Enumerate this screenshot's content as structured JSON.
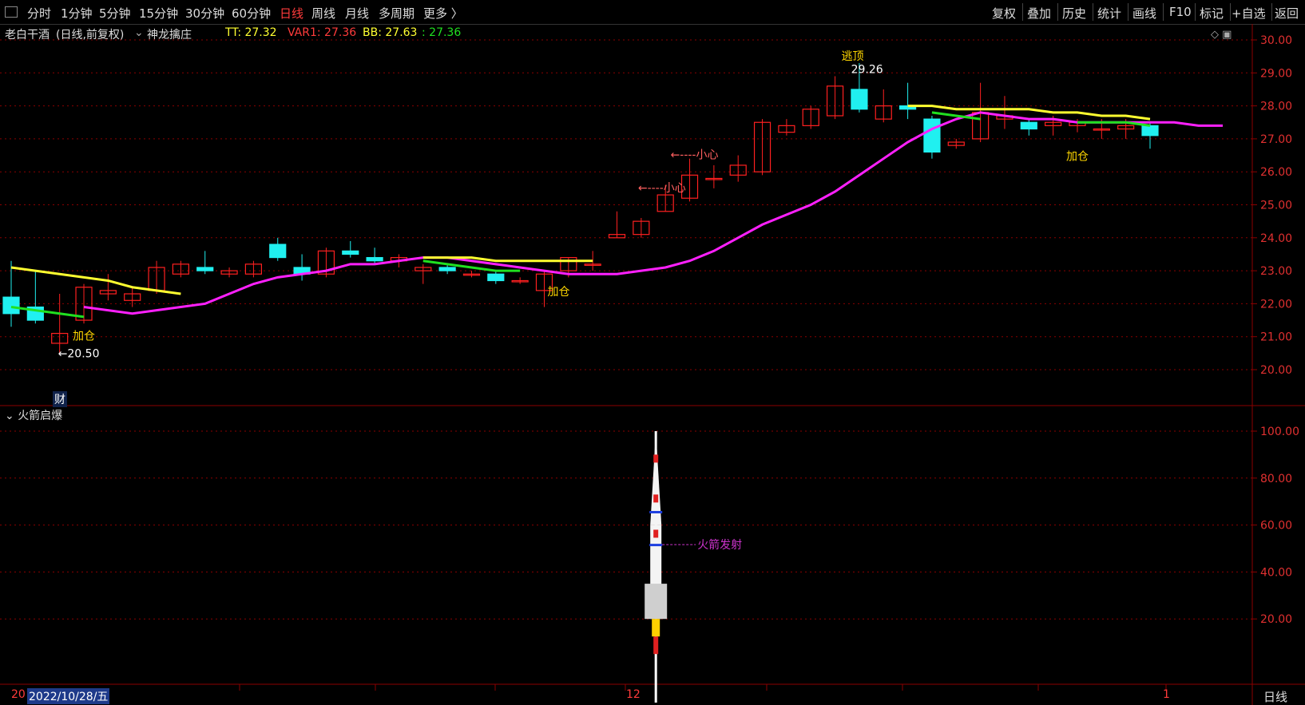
{
  "menu": {
    "left": [
      "分时",
      "1分钟",
      "5分钟",
      "15分钟",
      "30分钟",
      "60分钟",
      "日线",
      "周线",
      "月线",
      "多周期",
      "更多 〉"
    ],
    "active": "日线",
    "right": [
      "复权",
      "叠加",
      "历史",
      "统计",
      "画线",
      "F10",
      "标记",
      "+自选",
      "返回"
    ]
  },
  "stock": {
    "name": "老白干酒",
    "mode": "(日线,前复权)",
    "indicator": "神龙擒庄",
    "tt": "TT: 27.32",
    "var1": "VAR1: 27.36",
    "bb": "BB: 27.63",
    "bb2": ": 27.36"
  },
  "sub_panel": {
    "title": "火箭启爆",
    "label": "火箭发射"
  },
  "annotations": {
    "add1": "加仓",
    "add2": "加仓",
    "add3": "加仓",
    "low": "←20.50",
    "high": "29.26",
    "top": "逃顶",
    "careful1": "←----小心",
    "careful2": "←----小心",
    "finance": "财"
  },
  "bottom": {
    "start": "20",
    "date": "2022/10/28/五",
    "month12": "12",
    "month1": "1",
    "period": "日线"
  },
  "colors": {
    "up": "#ff2020",
    "down": "#20f0f0",
    "ma": "#ff20ff",
    "yellow": "#ffff30",
    "green": "#20e020",
    "grid": "#8b0000"
  },
  "chart_data": {
    "type": "candlestick",
    "main_axis": [
      "30.00",
      "29.00",
      "28.00",
      "27.00",
      "26.00",
      "25.00",
      "24.00",
      "23.00",
      "22.00",
      "21.00",
      "20.00"
    ],
    "sub_axis": [
      "100.00",
      "80.00",
      "60.00",
      "40.00",
      "20.00"
    ],
    "candles": [
      {
        "o": 22.2,
        "c": 21.7,
        "h": 23.3,
        "l": 21.3
      },
      {
        "o": 21.9,
        "c": 21.5,
        "h": 23.0,
        "l": 21.4
      },
      {
        "o": 20.8,
        "c": 21.1,
        "h": 22.3,
        "l": 20.5
      },
      {
        "o": 21.5,
        "c": 22.5,
        "h": 22.6,
        "l": 21.4
      },
      {
        "o": 22.3,
        "c": 22.4,
        "h": 22.9,
        "l": 22.1
      },
      {
        "o": 22.1,
        "c": 22.3,
        "h": 22.5,
        "l": 21.9
      },
      {
        "o": 22.4,
        "c": 23.1,
        "h": 23.3,
        "l": 22.3
      },
      {
        "o": 22.9,
        "c": 23.2,
        "h": 23.3,
        "l": 22.8
      },
      {
        "o": 23.1,
        "c": 23.0,
        "h": 23.6,
        "l": 22.9
      },
      {
        "o": 22.9,
        "c": 23.0,
        "h": 23.1,
        "l": 22.8
      },
      {
        "o": 22.9,
        "c": 23.2,
        "h": 23.3,
        "l": 22.8
      },
      {
        "o": 23.8,
        "c": 23.4,
        "h": 24.0,
        "l": 23.3
      },
      {
        "o": 23.1,
        "c": 22.9,
        "h": 23.5,
        "l": 22.7
      },
      {
        "o": 22.9,
        "c": 23.6,
        "h": 23.7,
        "l": 22.8
      },
      {
        "o": 23.6,
        "c": 23.5,
        "h": 23.9,
        "l": 23.4
      },
      {
        "o": 23.4,
        "c": 23.3,
        "h": 23.7,
        "l": 23.2
      },
      {
        "o": 23.3,
        "c": 23.4,
        "h": 23.5,
        "l": 23.1
      },
      {
        "o": 23.0,
        "c": 23.1,
        "h": 23.2,
        "l": 22.6
      },
      {
        "o": 23.1,
        "c": 23.0,
        "h": 23.2,
        "l": 22.9
      },
      {
        "o": 22.9,
        "c": 22.9,
        "h": 23.0,
        "l": 22.8
      },
      {
        "o": 22.9,
        "c": 22.7,
        "h": 23.0,
        "l": 22.6
      },
      {
        "o": 22.7,
        "c": 22.7,
        "h": 22.8,
        "l": 22.6
      },
      {
        "o": 22.4,
        "c": 22.9,
        "h": 23.0,
        "l": 21.9
      },
      {
        "o": 23.0,
        "c": 23.4,
        "h": 23.4,
        "l": 22.8
      },
      {
        "o": 23.2,
        "c": 23.2,
        "h": 23.6,
        "l": 23.0
      },
      {
        "o": 24.0,
        "c": 24.1,
        "h": 24.8,
        "l": 24.0
      },
      {
        "o": 24.1,
        "c": 24.5,
        "h": 24.6,
        "l": 24.0
      },
      {
        "o": 24.8,
        "c": 25.3,
        "h": 25.6,
        "l": 24.8
      },
      {
        "o": 25.2,
        "c": 25.9,
        "h": 26.4,
        "l": 25.1
      },
      {
        "o": 25.8,
        "c": 25.8,
        "h": 26.2,
        "l": 25.5
      },
      {
        "o": 25.9,
        "c": 26.2,
        "h": 26.5,
        "l": 25.7
      },
      {
        "o": 26.0,
        "c": 27.5,
        "h": 27.6,
        "l": 25.9
      },
      {
        "o": 27.2,
        "c": 27.4,
        "h": 27.6,
        "l": 27.1
      },
      {
        "o": 27.4,
        "c": 27.9,
        "h": 28.0,
        "l": 27.3
      },
      {
        "o": 27.7,
        "c": 28.6,
        "h": 28.9,
        "l": 27.6
      },
      {
        "o": 28.5,
        "c": 27.9,
        "h": 29.3,
        "l": 27.8
      },
      {
        "o": 27.6,
        "c": 28.0,
        "h": 28.5,
        "l": 27.5
      },
      {
        "o": 28.0,
        "c": 27.9,
        "h": 28.7,
        "l": 27.6
      },
      {
        "o": 27.6,
        "c": 26.6,
        "h": 27.7,
        "l": 26.4
      },
      {
        "o": 26.8,
        "c": 26.9,
        "h": 27.0,
        "l": 26.7
      },
      {
        "o": 27.0,
        "c": 27.8,
        "h": 28.7,
        "l": 26.9
      },
      {
        "o": 27.6,
        "c": 27.7,
        "h": 28.3,
        "l": 27.3
      },
      {
        "o": 27.5,
        "c": 27.3,
        "h": 27.6,
        "l": 27.1
      },
      {
        "o": 27.4,
        "c": 27.5,
        "h": 27.7,
        "l": 27.1
      },
      {
        "o": 27.4,
        "c": 27.5,
        "h": 27.6,
        "l": 27.2
      },
      {
        "o": 27.3,
        "c": 27.3,
        "h": 27.6,
        "l": 27.0
      },
      {
        "o": 27.3,
        "c": 27.4,
        "h": 27.6,
        "l": 27.0
      },
      {
        "o": 27.4,
        "c": 27.1,
        "h": 27.5,
        "l": 26.7
      }
    ],
    "ma_line": [
      21.9,
      21.8,
      21.7,
      21.8,
      21.9,
      22.0,
      22.3,
      22.6,
      22.8,
      22.9,
      23.0,
      23.2,
      23.2,
      23.3,
      23.4,
      23.4,
      23.3,
      23.2,
      23.1,
      23.0,
      22.9,
      22.9,
      22.9,
      23.0,
      23.1,
      23.3,
      23.6,
      24.0,
      24.4,
      24.7,
      25.0,
      25.4,
      25.9,
      26.4,
      26.9,
      27.3,
      27.6,
      27.8,
      27.7,
      27.6,
      27.6,
      27.5,
      27.5,
      27.5,
      27.5,
      27.5,
      27.4,
      27.4
    ],
    "rocket_index": 27
  }
}
